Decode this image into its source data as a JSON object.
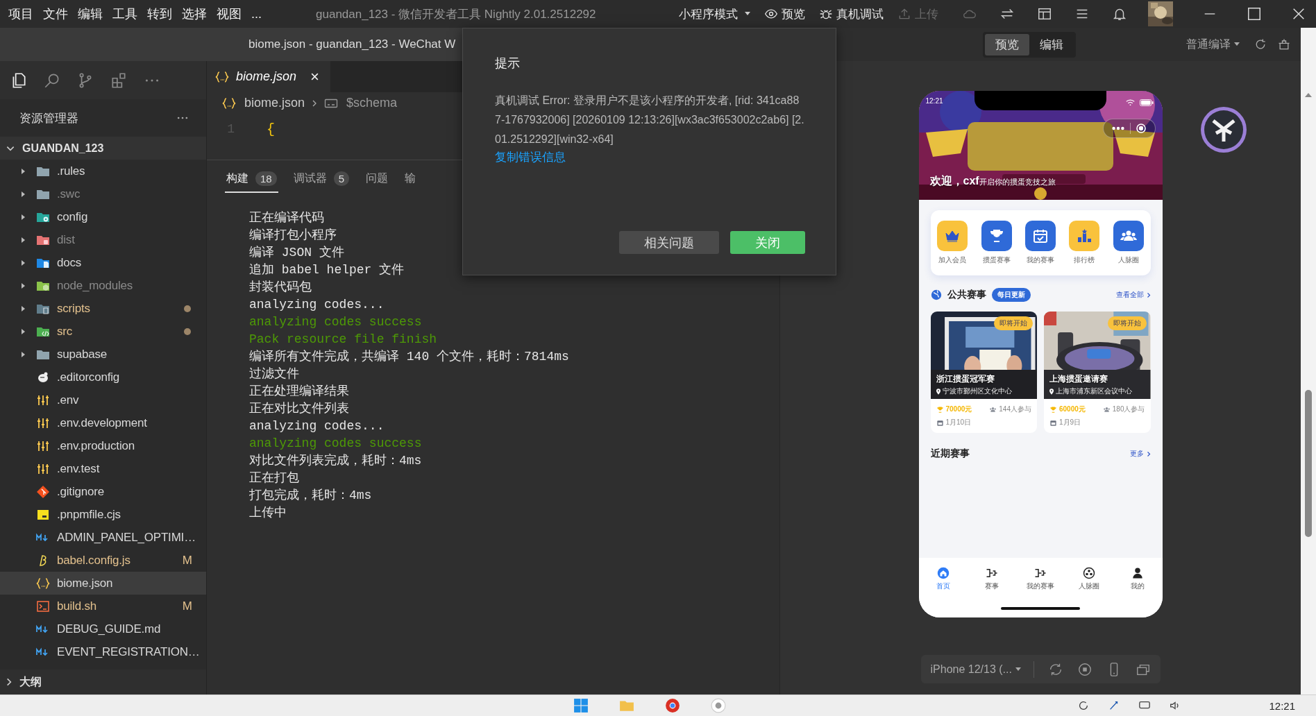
{
  "menu": [
    "项目",
    "文件",
    "编辑",
    "工具",
    "转到",
    "选择",
    "视图",
    "..."
  ],
  "window_title": "guandan_123 - 微信开发者工具 Nightly 2.01.2512292",
  "mode": "小程序模式",
  "toolbar_actions": [
    {
      "label": "预览",
      "kind": "preview",
      "disabled": false
    },
    {
      "label": "真机调试",
      "kind": "debug",
      "disabled": false
    },
    {
      "label": "上传",
      "kind": "upload",
      "disabled": true
    }
  ],
  "editor_title": "biome.json - guandan_123 - WeChat W",
  "sim_toggle": [
    {
      "label": "预览",
      "selected": true
    },
    {
      "label": "编辑",
      "selected": false
    }
  ],
  "compile_mode": "普通编译",
  "explorer": {
    "title": "资源管理器",
    "root": "GUANDAN_123",
    "items": [
      {
        "name": ".rules",
        "kind": "folder",
        "ignored": false,
        "modified": false,
        "expanded": false,
        "selected": false
      },
      {
        "name": ".swc",
        "kind": "folder",
        "ignored": true,
        "modified": false,
        "expanded": false,
        "selected": false
      },
      {
        "name": "config",
        "kind": "folder-config",
        "ignored": false,
        "modified": false,
        "expanded": false,
        "selected": false
      },
      {
        "name": "dist",
        "kind": "folder-dist",
        "ignored": true,
        "modified": false,
        "expanded": false,
        "selected": false
      },
      {
        "name": "docs",
        "kind": "folder-docs",
        "ignored": false,
        "modified": false,
        "expanded": false,
        "selected": false
      },
      {
        "name": "node_modules",
        "kind": "folder-node",
        "ignored": true,
        "modified": false,
        "expanded": false,
        "selected": false
      },
      {
        "name": "scripts",
        "kind": "folder-scripts",
        "ignored": false,
        "modified": true,
        "expanded": false,
        "selected": false
      },
      {
        "name": "src",
        "kind": "folder-src",
        "ignored": false,
        "modified": true,
        "expanded": false,
        "selected": false
      },
      {
        "name": "supabase",
        "kind": "folder",
        "ignored": false,
        "modified": false,
        "expanded": false,
        "selected": false
      },
      {
        "name": ".editorconfig",
        "kind": "editorconfig",
        "ignored": false,
        "modified": false,
        "selected": false
      },
      {
        "name": ".env",
        "kind": "env",
        "ignored": false,
        "modified": false,
        "selected": false
      },
      {
        "name": ".env.development",
        "kind": "env",
        "ignored": false,
        "modified": false,
        "selected": false
      },
      {
        "name": ".env.production",
        "kind": "env",
        "ignored": false,
        "modified": false,
        "selected": false
      },
      {
        "name": ".env.test",
        "kind": "env",
        "ignored": false,
        "modified": false,
        "selected": false
      },
      {
        "name": ".gitignore",
        "kind": "git",
        "ignored": false,
        "modified": false,
        "selected": false
      },
      {
        "name": ".pnpmfile.cjs",
        "kind": "js",
        "ignored": false,
        "modified": false,
        "selected": false
      },
      {
        "name": "ADMIN_PANEL_OPTIMI…",
        "kind": "markdown",
        "ignored": false,
        "modified": false,
        "selected": false
      },
      {
        "name": "babel.config.js",
        "kind": "babel",
        "ignored": false,
        "modified": true,
        "badge": "M",
        "selected": false
      },
      {
        "name": "biome.json",
        "kind": "json",
        "ignored": false,
        "modified": false,
        "selected": true
      },
      {
        "name": "build.sh",
        "kind": "shell",
        "ignored": false,
        "modified": true,
        "badge": "M",
        "selected": false
      },
      {
        "name": "DEBUG_GUIDE.md",
        "kind": "markdown",
        "ignored": false,
        "modified": false,
        "selected": false
      },
      {
        "name": "EVENT_REGISTRATION…",
        "kind": "markdown",
        "ignored": false,
        "modified": false,
        "selected": false
      }
    ]
  },
  "outline": "大纲",
  "editor_tab": "biome.json",
  "breadcrumb": [
    "biome.json",
    "$schema"
  ],
  "code": [
    {
      "line": "1",
      "text": "{"
    }
  ],
  "panel_tabs": [
    {
      "label": "构建",
      "count": "18",
      "selected": true
    },
    {
      "label": "调试器",
      "count": "5",
      "selected": false
    },
    {
      "label": "问题",
      "selected": false
    },
    {
      "label": "输",
      "selected": false
    }
  ],
  "console": [
    {
      "text": "正在编译代码",
      "kind": "info"
    },
    {
      "text": "编译打包小程序",
      "kind": "info"
    },
    {
      "text": "编译 JSON 文件",
      "kind": "info"
    },
    {
      "text": "追加 babel helper 文件",
      "kind": "info"
    },
    {
      "text": "封装代码包",
      "kind": "info"
    },
    {
      "text": "analyzing codes...",
      "kind": "info"
    },
    {
      "text": "analyzing codes success",
      "kind": "success"
    },
    {
      "text": "Pack resource file finish",
      "kind": "success"
    },
    {
      "text": "编译所有文件完成，共编译 140 个文件，耗时：7814ms",
      "kind": "info"
    },
    {
      "text": "过滤文件",
      "kind": "info"
    },
    {
      "text": "正在处理编译结果",
      "kind": "info"
    },
    {
      "text": "正在对比文件列表",
      "kind": "info"
    },
    {
      "text": "analyzing codes...",
      "kind": "info"
    },
    {
      "text": "analyzing codes success",
      "kind": "success"
    },
    {
      "text": "对比文件列表完成，耗时：4ms",
      "kind": "info"
    },
    {
      "text": "正在打包",
      "kind": "info"
    },
    {
      "text": "打包完成，耗时：4ms",
      "kind": "info"
    },
    {
      "text": "上传中",
      "kind": "info"
    }
  ],
  "dialog": {
    "title": "提示",
    "message": "真机调试 Error: 登录用户不是该小程序的开发者, [rid: 341ca887-1767932006] [20260109 12:13:26][wx3ac3f653002c2ab6] [2.01.2512292][win32-x64]",
    "link": "复制错误信息",
    "buttons": [
      {
        "label": "相关问题",
        "kind": "secondary"
      },
      {
        "label": "关闭",
        "kind": "primary"
      }
    ]
  },
  "phone": {
    "time": "12:21",
    "welcome": "欢迎，cxf",
    "tagline": "开启你的掼蛋竞技之旅",
    "shortcuts": [
      {
        "label": "加入会员",
        "color": "#f9c23c"
      },
      {
        "label": "掼蛋赛事",
        "color": "#2f6ad8"
      },
      {
        "label": "我的赛事",
        "color": "#2f6ad8"
      },
      {
        "label": "排行榜",
        "color": "#f9c23c"
      },
      {
        "label": "人脉圈",
        "color": "#2f6ad8"
      }
    ],
    "section": {
      "title": "公共赛事",
      "badge": "每日更新",
      "more": "查看全部"
    },
    "events": [
      {
        "status": "即将开始",
        "title": "浙江掼蛋冠军赛",
        "location": "宁波市鄞州区文化中心",
        "prize": "70000元",
        "participants": "144人参与",
        "date": "1月10日"
      },
      {
        "status": "即将开始",
        "title": "上海掼蛋邀请赛",
        "location": "上海市浦东新区会议中心",
        "prize": "60000元",
        "participants": "180人参与",
        "date": "1月9日"
      }
    ],
    "recent": {
      "title": "近期赛事",
      "more": "更多"
    },
    "tabs": [
      {
        "label": "首页",
        "selected": true
      },
      {
        "label": "赛事",
        "selected": false
      },
      {
        "label": "我的赛事",
        "selected": false
      },
      {
        "label": "人脉圈",
        "selected": false
      },
      {
        "label": "我的",
        "selected": false
      }
    ]
  },
  "device": "iPhone 12/13 (...",
  "clock": "12:21"
}
